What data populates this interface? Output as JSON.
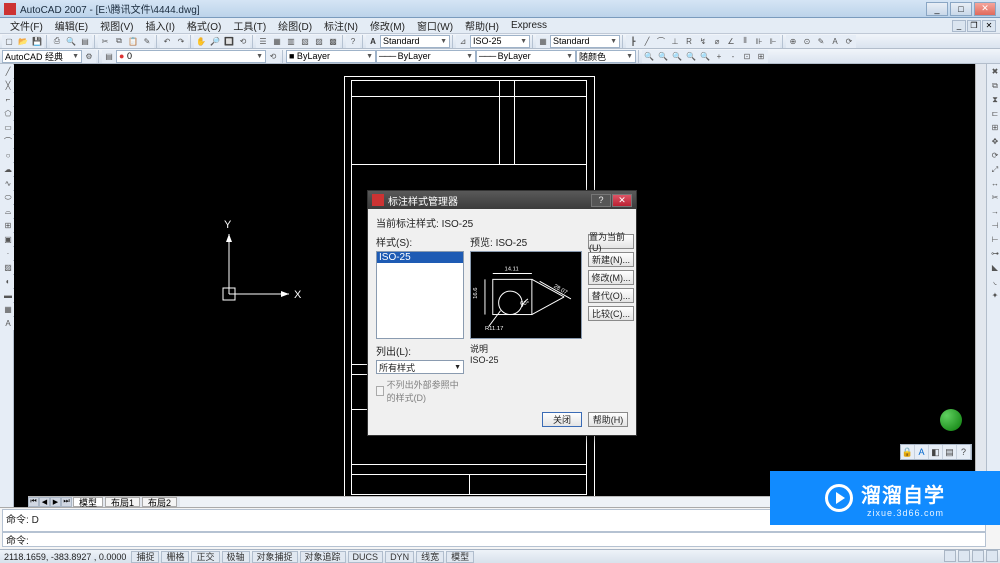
{
  "app": {
    "name": "AutoCAD 2007",
    "doc": "[E:\\腾讯文件\\4444.dwg]"
  },
  "menus": [
    "文件(F)",
    "编辑(E)",
    "视图(V)",
    "插入(I)",
    "格式(O)",
    "工具(T)",
    "绘图(D)",
    "标注(N)",
    "修改(M)",
    "窗口(W)",
    "帮助(H)",
    "Express"
  ],
  "workspace": {
    "label": "AutoCAD 经典"
  },
  "styles_row": {
    "text_style": "Standard",
    "dim_style": "ISO-25",
    "table_style": "Standard"
  },
  "layers_row": {
    "layer": "0",
    "color": "■ ByLayer",
    "linetype": "ByLayer",
    "lineweight": "ByLayer",
    "plot": "随颜色"
  },
  "tabs": {
    "model": "模型",
    "l1": "布局1",
    "l2": "布局2"
  },
  "cmd": {
    "prompt": "命令:",
    "input": "D",
    "history": ""
  },
  "status": {
    "coords": "2118.1659, -383.8927 , 0.0000",
    "buttons": [
      "捕捉",
      "栅格",
      "正交",
      "极轴",
      "对象捕捉",
      "对象追踪",
      "DUCS",
      "DYN",
      "线宽",
      "模型"
    ]
  },
  "dialog": {
    "title": "标注样式管理器",
    "current_label": "当前标注样式:",
    "current_value": "ISO-25",
    "styles_label": "样式(S):",
    "list_selected": "ISO-25",
    "preview_label": "预览:",
    "preview_value": "ISO-25",
    "preview_dims": {
      "top": "14.11",
      "left": "16.6",
      "right": "28.07",
      "radius": "R11.17",
      "angle": "60°"
    },
    "listfilter_label": "列出(L):",
    "listfilter_value": "所有样式",
    "extref_check": "不列出外部参照中的样式(D)",
    "desc_label": "说明",
    "desc_value": "ISO-25",
    "buttons": {
      "set_current": "置为当前(U)",
      "new": "新建(N)...",
      "modify": "修改(M)...",
      "override": "替代(O)...",
      "compare": "比较(C)..."
    },
    "close": "关闭",
    "help": "帮助(H)"
  },
  "watermark": {
    "brand": "溜溜自学",
    "url": "zixue.3d66.com"
  }
}
